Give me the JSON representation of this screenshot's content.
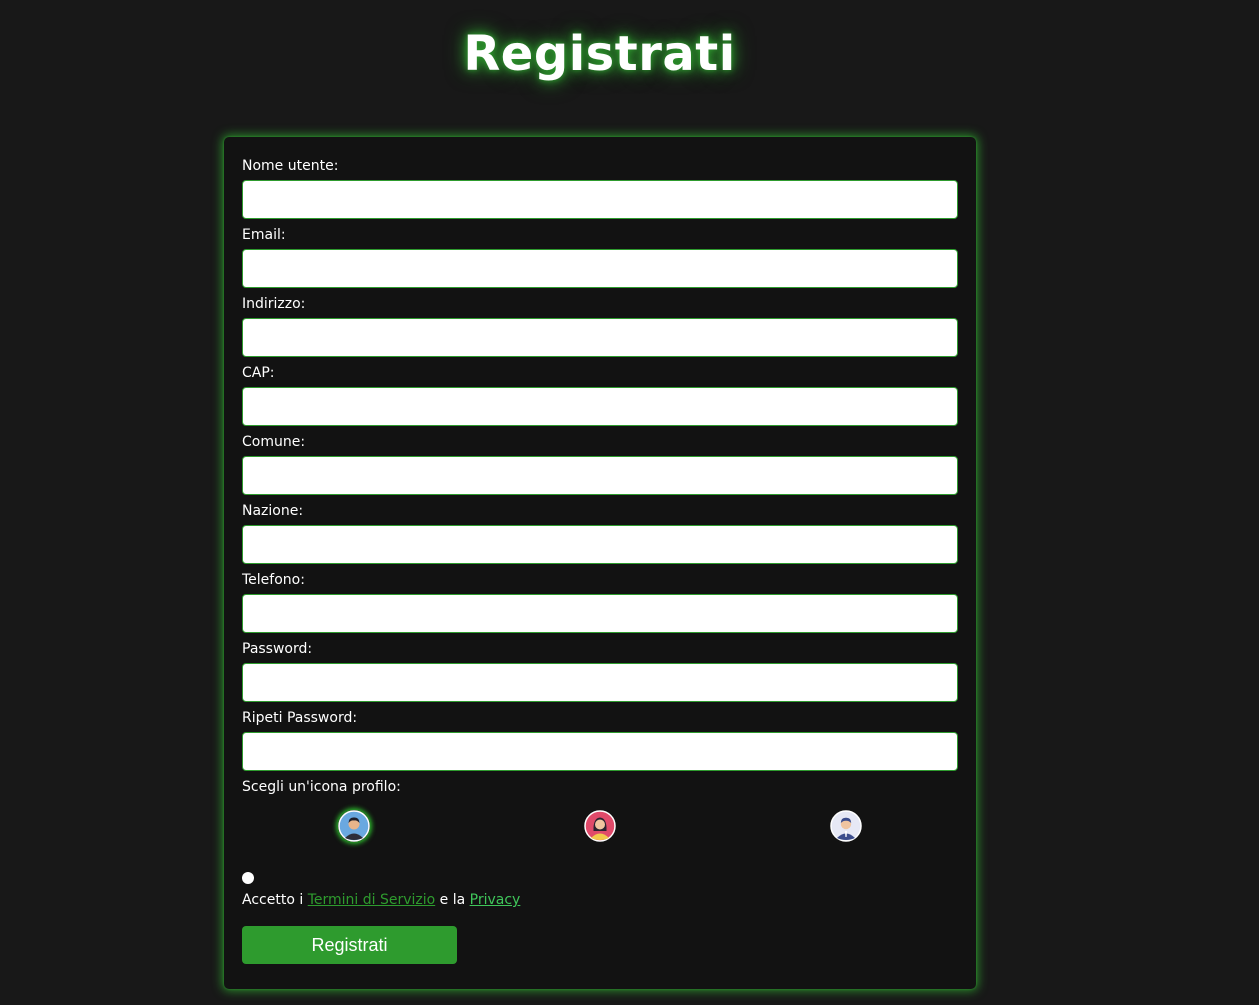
{
  "page": {
    "title": "Registrati"
  },
  "form": {
    "fields": [
      {
        "label": "Nome utente:",
        "value": "",
        "placeholder": ""
      },
      {
        "label": "Email:",
        "value": "",
        "placeholder": ""
      },
      {
        "label": "Indirizzo:",
        "value": "",
        "placeholder": ""
      },
      {
        "label": "CAP:",
        "value": "",
        "placeholder": ""
      },
      {
        "label": "Comune:",
        "value": "",
        "placeholder": ""
      },
      {
        "label": "Nazione:",
        "value": "",
        "placeholder": ""
      },
      {
        "label": "Telefono:",
        "value": "",
        "placeholder": ""
      },
      {
        "label": "Password:",
        "value": "",
        "placeholder": ""
      },
      {
        "label": "Ripeti Password:",
        "value": "",
        "placeholder": ""
      }
    ],
    "profile_icon": {
      "label": "Scegli un'icona profilo:",
      "options": [
        {
          "icon": "avatar-man-dark-hair-icon",
          "selected": true
        },
        {
          "icon": "avatar-woman-icon",
          "selected": false
        },
        {
          "icon": "avatar-man-suit-icon",
          "selected": false
        }
      ]
    },
    "terms": {
      "prefix": "Accetto i",
      "terms_link": "Termini di Servizio",
      "middle": "e la",
      "privacy_link": "Privacy"
    },
    "submit_label": "Registrati"
  },
  "colors": {
    "background": "#181818",
    "card": "#121212",
    "accent": "#2e9b2e",
    "link_privacy": "#3fc65a"
  }
}
